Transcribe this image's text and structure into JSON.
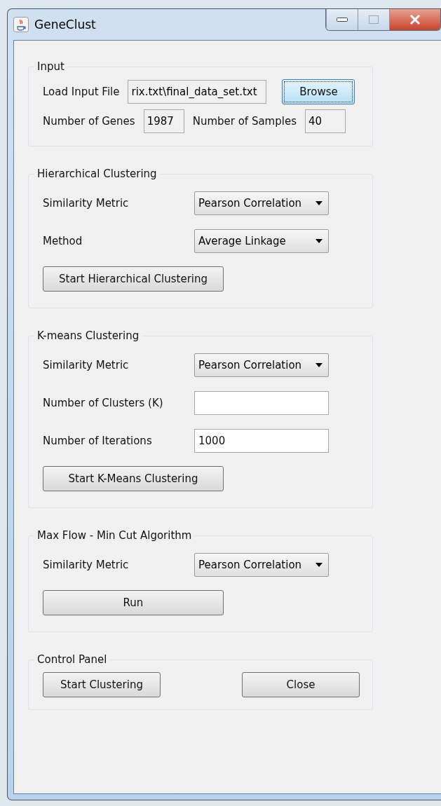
{
  "window": {
    "title": "GeneClust"
  },
  "sections": [
    {
      "title": "Input",
      "kind": "inline",
      "rows": [
        {
          "items": [
            {
              "kind": "label",
              "text": "Load Input File"
            },
            {
              "kind": "pathbox",
              "value": "rix.txt\\final_data_set.txt"
            },
            {
              "kind": "button",
              "label": "Browse",
              "focused": true
            }
          ]
        },
        {
          "items": [
            {
              "kind": "label",
              "text": "Number of Genes"
            },
            {
              "kind": "countbox",
              "value": "1987"
            },
            {
              "kind": "label",
              "text": "Number of Samples"
            },
            {
              "kind": "countbox",
              "value": "40"
            }
          ]
        }
      ]
    },
    {
      "title": "Hierarchical Clustering",
      "kind": "grid",
      "rows": [
        {
          "items": [
            {
              "kind": "label",
              "text": "Similarity Metric"
            },
            {
              "kind": "select",
              "value": "Pearson Correlation"
            }
          ]
        },
        {
          "items": [
            {
              "kind": "label",
              "text": "Method"
            },
            {
              "kind": "select",
              "value": "Average Linkage"
            }
          ]
        },
        {
          "items": [
            {
              "kind": "button",
              "label": "Start Hierarchical Clustering",
              "focused": false
            }
          ]
        }
      ]
    },
    {
      "title": "K-means Clustering",
      "kind": "grid",
      "rows": [
        {
          "items": [
            {
              "kind": "label",
              "text": "Similarity Metric"
            },
            {
              "kind": "select",
              "value": "Pearson Correlation"
            }
          ]
        },
        {
          "items": [
            {
              "kind": "label",
              "text": "Number of Clusters (K)"
            },
            {
              "kind": "field"
            }
          ]
        },
        {
          "items": [
            {
              "kind": "label",
              "text": "Number of Iterations"
            },
            {
              "kind": "field",
              "value": "1000"
            }
          ]
        },
        {
          "items": [
            {
              "kind": "button",
              "label": "Start K-Means Clustering",
              "focused": false
            }
          ]
        }
      ]
    },
    {
      "title": "Max Flow - Min Cut Algorithm",
      "kind": "grid",
      "rows": [
        {
          "items": [
            {
              "kind": "label",
              "text": "Similarity Metric"
            },
            {
              "kind": "select",
              "value": "Pearson Correlation"
            }
          ]
        },
        {
          "items": [
            {
              "kind": "button",
              "label": "Run",
              "focused": false
            }
          ]
        }
      ]
    },
    {
      "title": "Control Panel",
      "kind": "spread",
      "rows": [
        {
          "items": [
            {
              "kind": "button",
              "label": "Start Clustering",
              "focused": false
            },
            {
              "kind": "button",
              "label": "Close",
              "focused": false
            }
          ]
        }
      ]
    }
  ]
}
